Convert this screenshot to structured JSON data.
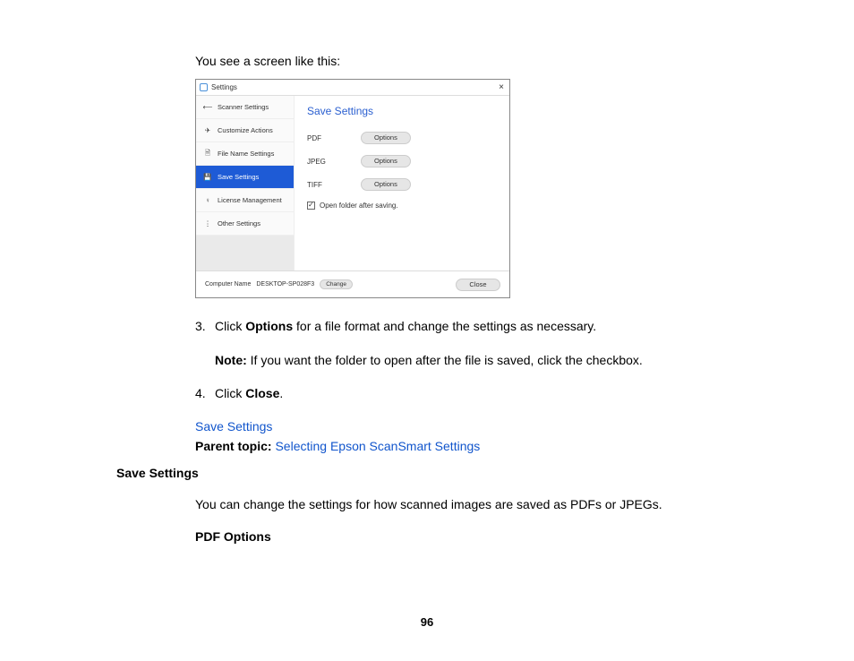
{
  "intro": "You see a screen like this:",
  "dialog": {
    "title": "Settings",
    "sidebar": [
      "Scanner Settings",
      "Customize Actions",
      "File Name Settings",
      "Save Settings",
      "License Management",
      "Other Settings"
    ],
    "panel_title": "Save Settings",
    "rows": [
      {
        "label": "PDF",
        "button": "Options"
      },
      {
        "label": "JPEG",
        "button": "Options"
      },
      {
        "label": "TIFF",
        "button": "Options"
      }
    ],
    "checkbox_label": "Open folder after saving.",
    "footer": {
      "cn_label": "Computer Name",
      "cn_value": "DESKTOP-SP028F3",
      "change": "Change",
      "close": "Close"
    }
  },
  "steps": {
    "s3_num": "3.",
    "s3_a": "Click ",
    "s3_b": "Options",
    "s3_c": " for a file format and change the settings as necessary.",
    "note_label": "Note:",
    "note_text": " If you want the folder to open after the file is saved, click the checkbox.",
    "s4_num": "4.",
    "s4_a": "Click ",
    "s4_b": "Close",
    "s4_c": "."
  },
  "links": {
    "save_settings": "Save Settings",
    "parent_label": "Parent topic:",
    "parent_link": "Selecting Epson ScanSmart Settings"
  },
  "section_heading": "Save Settings",
  "section_body": "You can change the settings for how scanned images are saved as PDFs or JPEGs.",
  "sub_heading": "PDF Options",
  "page_number": "96"
}
